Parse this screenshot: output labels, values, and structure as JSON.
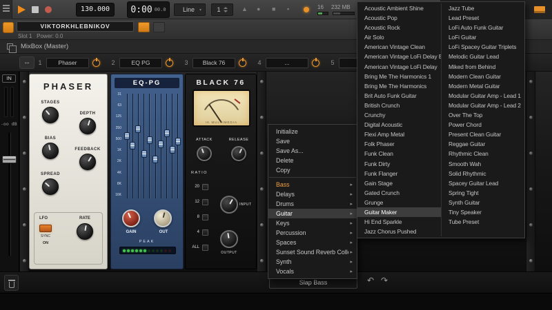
{
  "icons": {
    "submenu_arrow": "▸",
    "dropdown_caret": "▾",
    "undo": "↶",
    "redo": "↷",
    "chain": "↔",
    "metronome": "▲",
    "wait": "●",
    "overdub": "■",
    "loop_record": "▪"
  },
  "toolbar": {
    "tempo": "130.000",
    "time_main": "0:00",
    "time_sub": "00.0",
    "snap": "Line",
    "pattern": "1",
    "bars": "16",
    "memory": "232 MB"
  },
  "track": {
    "name": "VIKTORKHLEBNIKOV",
    "hint": "Slot 1   Power: 0.0"
  },
  "window_title": "MixBox (Master)",
  "slots": [
    {
      "num": "1",
      "name": "Phaser",
      "state": "on"
    },
    {
      "num": "2",
      "name": "EQ PG",
      "state": "on"
    },
    {
      "num": "3",
      "name": "Black 76",
      "state": "on"
    },
    {
      "num": "4",
      "name": "...",
      "state": "on"
    },
    {
      "num": "5",
      "name": "",
      "state": "off"
    }
  ],
  "in_strip": {
    "label": "IN",
    "gain_readout": "-oo dB"
  },
  "phaser": {
    "title": "PHASER",
    "knobs": [
      "STAGES",
      "DEPTH",
      "BIAS",
      "FEEDBACK",
      "SPREAD"
    ],
    "lfo_label": "LFO",
    "sync_label": "SYNC",
    "on_label": "ON",
    "rate_label": "RATE"
  },
  "eq": {
    "title": "EQ-PG",
    "bands": [
      "31",
      "63",
      "125",
      "250",
      "500",
      "1K",
      "2K",
      "4K",
      "8K",
      "16K"
    ],
    "gain_label": "GAIN",
    "out_label": "OUT",
    "peak_label": "PEAK"
  },
  "comp": {
    "title": "BLACK 76",
    "brand": "IK MULTIMEDIA",
    "attack_label": "ATTACK",
    "release_label": "RELEASE",
    "ratio_label": "RATIO",
    "ratios": [
      "20",
      "12",
      "8",
      "4",
      "ALL"
    ],
    "input_label": "INPUT",
    "output_label": "OUTPUT"
  },
  "preset_bar": {
    "current": "Slap Bass"
  },
  "context_menu": {
    "actions": [
      "Initialize",
      "Save",
      "Save As...",
      "Delete",
      "Copy"
    ],
    "categories": [
      {
        "label": "Bass",
        "state": "active"
      },
      {
        "label": "Delays"
      },
      {
        "label": "Drums"
      },
      {
        "label": "Guitar",
        "state": "hover"
      },
      {
        "label": "Keys"
      },
      {
        "label": "Percussion"
      },
      {
        "label": "Spaces"
      },
      {
        "label": "Sunset Sound Reverb Collection"
      },
      {
        "label": "Synth"
      },
      {
        "label": "Vocals"
      }
    ]
  },
  "guitar_submenu": {
    "highlighted": "Guitar Maker",
    "col1": [
      "Acoustic Ambient Shine",
      "Acoustic Pop",
      "Acoustic Rock",
      "Air Solo",
      "American Vintage Clean",
      "American Vintage LoFi Delay B",
      "American Vintage LoFi Delay",
      "Bring Me The Harmonics 1",
      "Bring Me The Harmonics",
      "Brit Auto Funk Guitar",
      "British Crunch",
      "Crunchy",
      "Digital Acoustic",
      "Flexi Amp Metal",
      "Folk Phaser",
      "Funk Clean",
      "Funk Dirty",
      "Funk Flanger",
      "Gain Stage",
      "Gated Crunch",
      "Grunge",
      "Guitar Maker",
      "Hi End Sparkle",
      "Jazz Chorus Pushed"
    ],
    "col2": [
      "Jazz Tube",
      "Lead Preset",
      "LoFi Auto Funk Guitar",
      "LoFi Guitar",
      "LoFi Spacey Guitar Triplets",
      "Melodic Guitar Lead",
      "Miked from Behind",
      "Modern Clean Guitar",
      "Modern Metal Guitar",
      "Modular Guitar Amp - Lead 1",
      "Modular Guitar Amp - Lead 2",
      "Over The Top",
      "Power Chord",
      "Present Clean Guitar",
      "Reggae Guitar",
      "Rhythmic Clean",
      "Smooth Wah",
      "Solid Rhythmic",
      "Spacey Guitar Lead",
      "Spring Tight",
      "Synth Guitar",
      "Tiny Speaker",
      "Tube Preset"
    ]
  }
}
